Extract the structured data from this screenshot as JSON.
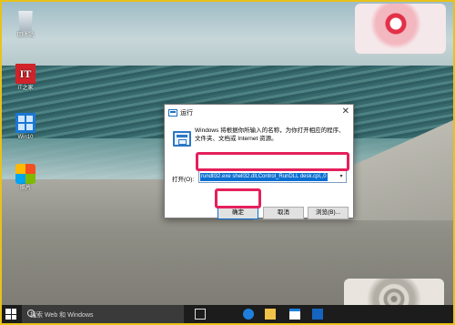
{
  "desktop": {
    "icons": [
      {
        "label": "回收站",
        "icon": "recycle-bin-icon"
      },
      {
        "label": "IT之家",
        "icon": "it-home-icon"
      },
      {
        "label": "Win10",
        "icon": "windows-icon"
      },
      {
        "label": "照片",
        "icon": "photos-icon"
      }
    ]
  },
  "run_dialog": {
    "title": "运行",
    "description": "Windows 将根据你所输入的名称，为你打开相应的程序、文件夹、文档或 Internet 资源。",
    "open_label": "打开(O):",
    "command_value": "rundll32.exe shell32.dll,Control_RunDLL desk.cpl,,0",
    "ok_label": "确定",
    "cancel_label": "取消",
    "browse_label": "浏览(B)...",
    "close_glyph": "✕",
    "dropdown_glyph": "▾"
  },
  "taskbar": {
    "search_placeholder": "搜索 Web 和 Windows"
  },
  "colors": {
    "highlight": "#e5205c",
    "frame": "#e8c21a",
    "selection": "#0b6fd1"
  }
}
